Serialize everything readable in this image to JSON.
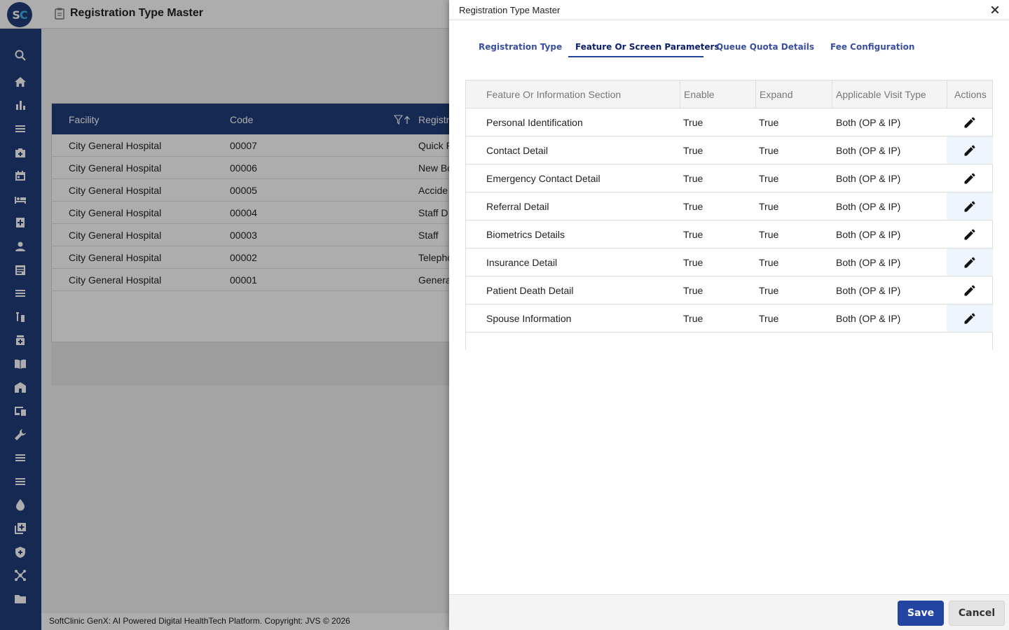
{
  "app": {
    "logo_text_s": "S",
    "logo_text_c": "C",
    "page_title": "Registration Type Master",
    "footer_text": "SoftClinic GenX: AI Powered Digital HealthTech Platform. Copyright: JVS © 2026"
  },
  "sidebar": {
    "icons": [
      "search-icon",
      "home-icon",
      "bar-chart-icon",
      "menu-icon",
      "medical-bag-icon",
      "calendar-icon",
      "bed-icon",
      "hospital-plus-icon",
      "person-icon",
      "document-icon",
      "menu-icon",
      "lab-icon",
      "pharmacy-icon",
      "book-icon",
      "building-icon",
      "devices-icon",
      "wrench-icon",
      "menu-icon",
      "menu-icon",
      "drop-icon",
      "add-box-icon",
      "shield-icon",
      "network-icon",
      "folder-icon"
    ]
  },
  "grid": {
    "headers": {
      "facility": "Facility",
      "code": "Code",
      "reg": "Registra"
    },
    "rows": [
      {
        "facility": "City General Hospital",
        "code": "00007",
        "reg": "Quick R"
      },
      {
        "facility": "City General Hospital",
        "code": "00006",
        "reg": "New Bo"
      },
      {
        "facility": "City General Hospital",
        "code": "00005",
        "reg": "Accide"
      },
      {
        "facility": "City General Hospital",
        "code": "00004",
        "reg": "Staff D"
      },
      {
        "facility": "City General Hospital",
        "code": "00003",
        "reg": "Staff"
      },
      {
        "facility": "City General Hospital",
        "code": "00002",
        "reg": "Telepho"
      },
      {
        "facility": "City General Hospital",
        "code": "00001",
        "reg": "Genera"
      }
    ]
  },
  "drawer": {
    "title": "Registration Type Master",
    "tabs": [
      {
        "label": "Registration Type",
        "active": false
      },
      {
        "label": "Feature Or Screen Parameters",
        "active": true
      },
      {
        "label": "Queue Quota Details",
        "active": false
      },
      {
        "label": "Fee Configuration",
        "active": false
      }
    ],
    "table": {
      "headers": {
        "section": "Feature Or Information Section",
        "enable": "Enable",
        "expand": "Expand",
        "visit_type": "Applicable Visit Type",
        "actions": "Actions"
      },
      "rows": [
        {
          "section": "Personal Identification",
          "enable": "True",
          "expand": "True",
          "visit_type": "Both (OP & IP)"
        },
        {
          "section": "Contact Detail",
          "enable": "True",
          "expand": "True",
          "visit_type": "Both (OP & IP)"
        },
        {
          "section": "Emergency Contact Detail",
          "enable": "True",
          "expand": "True",
          "visit_type": "Both (OP & IP)"
        },
        {
          "section": "Referral Detail",
          "enable": "True",
          "expand": "True",
          "visit_type": "Both (OP & IP)"
        },
        {
          "section": "Biometrics Details",
          "enable": "True",
          "expand": "True",
          "visit_type": "Both (OP & IP)"
        },
        {
          "section": "Insurance Detail",
          "enable": "True",
          "expand": "True",
          "visit_type": "Both (OP & IP)"
        },
        {
          "section": "Patient Death Detail",
          "enable": "True",
          "expand": "True",
          "visit_type": "Both (OP & IP)"
        },
        {
          "section": "Spouse Information",
          "enable": "True",
          "expand": "True",
          "visit_type": "Both (OP & IP)"
        }
      ]
    },
    "buttons": {
      "save": "Save",
      "cancel": "Cancel"
    }
  },
  "colors": {
    "brand_navy": "#1f3d7a",
    "primary_button": "#2344a0",
    "tab_active": "#0b1f6a",
    "tab_inactive": "#3a4f9f"
  }
}
